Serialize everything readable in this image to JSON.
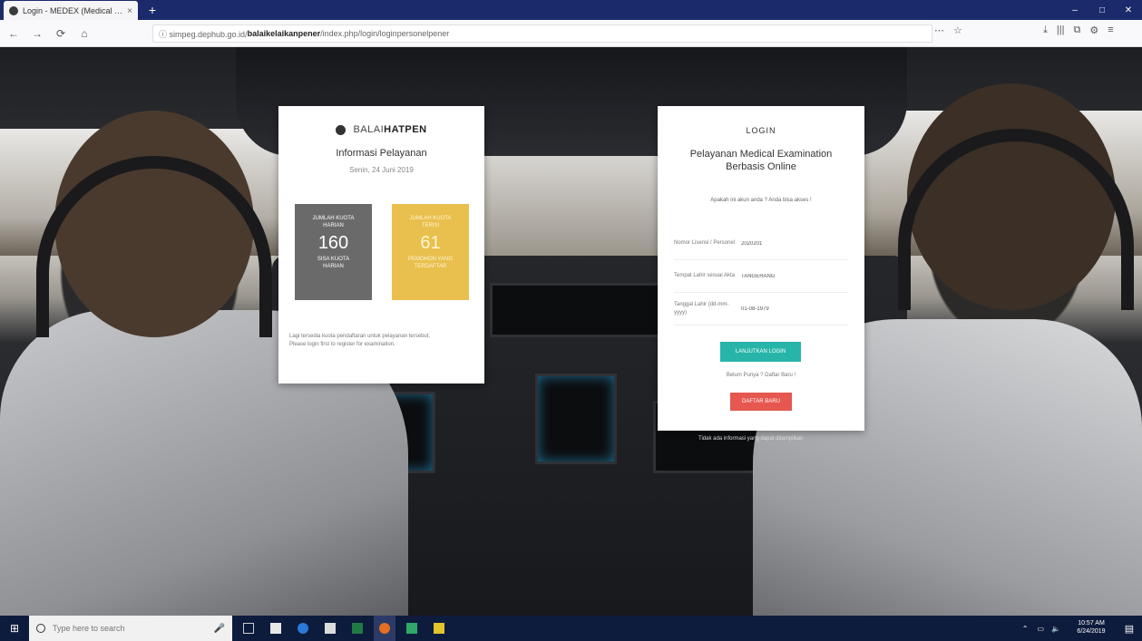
{
  "browser": {
    "tab_title": "Login - MEDEX (Medical Examin...",
    "tab_close": "×",
    "new_tab": "+",
    "back": "←",
    "forward": "→",
    "reload": "⟳",
    "home": "⌂",
    "url_prefix": "ⓘ  simpeg.dephub.go.id/",
    "url_domain": "balaikelaikanpener",
    "url_rest": "/index.php/login/loginpersonelpener",
    "window_controls": [
      "–",
      "□",
      "✕"
    ],
    "toolbar_icons": [
      "⋯",
      "☆",
      "⤓",
      "|||",
      "⧉",
      "⚙",
      "≡"
    ]
  },
  "info_card": {
    "brand_prefix": "BALAI",
    "brand_name": "HATPEN",
    "title": "Informasi Pelayanan",
    "date": "Senin, 24 Juni 2019",
    "stats": [
      {
        "top": "JUMLAH KUOTA",
        "mid": "HARIAN",
        "number": "160",
        "bottom": "SISA KUOTA",
        "bottom2": "HARIAN"
      },
      {
        "top": "JUMLAH KUOTA",
        "mid": "TERISI",
        "number": "61",
        "bottom": "PEMOHON YANG",
        "bottom2": "TERDAFTAR"
      }
    ],
    "note_1": "Lagi tersedia kuota pendaftaran untuk pelayanan tersebut.",
    "note_2": "Please login first to register for examination."
  },
  "login_card": {
    "title": "LOGIN",
    "subtitle": "Pelayanan Medical Examination Berbasis Online",
    "hint": "Apakah ini akun anda ? Anda bisa akses !",
    "fields": [
      {
        "label": "Nomor Lisensi / Personel",
        "value": "2020201"
      },
      {
        "label": "Tempat Lahir sesuai Akta",
        "value": "TANGERANG"
      },
      {
        "label": "Tanggal Lahir (dd-mm-yyyy)",
        "value": "01-08-1979"
      }
    ],
    "submit_label": "LANJUTKAN LOGIN",
    "forgot": "Belum Punya ? Daftar Baru !",
    "register_label": "DAFTAR BARU"
  },
  "under_note": "Tidak ada informasi yang dapat ditampilkan",
  "taskbar": {
    "start": "⊞",
    "search_placeholder": "Type here to search",
    "mic": "🎤",
    "time": "10:57 AM",
    "date": "6/24/2019",
    "tray_icons": [
      "⌃",
      "▭",
      "🔈"
    ],
    "notification": "▤"
  },
  "colors": {
    "stat_gray": "#6a6a6a",
    "stat_yellow": "#e9c04d",
    "submit": "#26b5a8",
    "register": "#e5574f",
    "titlebar": "#1b2a6b",
    "taskbar": "#0d1b3c"
  }
}
